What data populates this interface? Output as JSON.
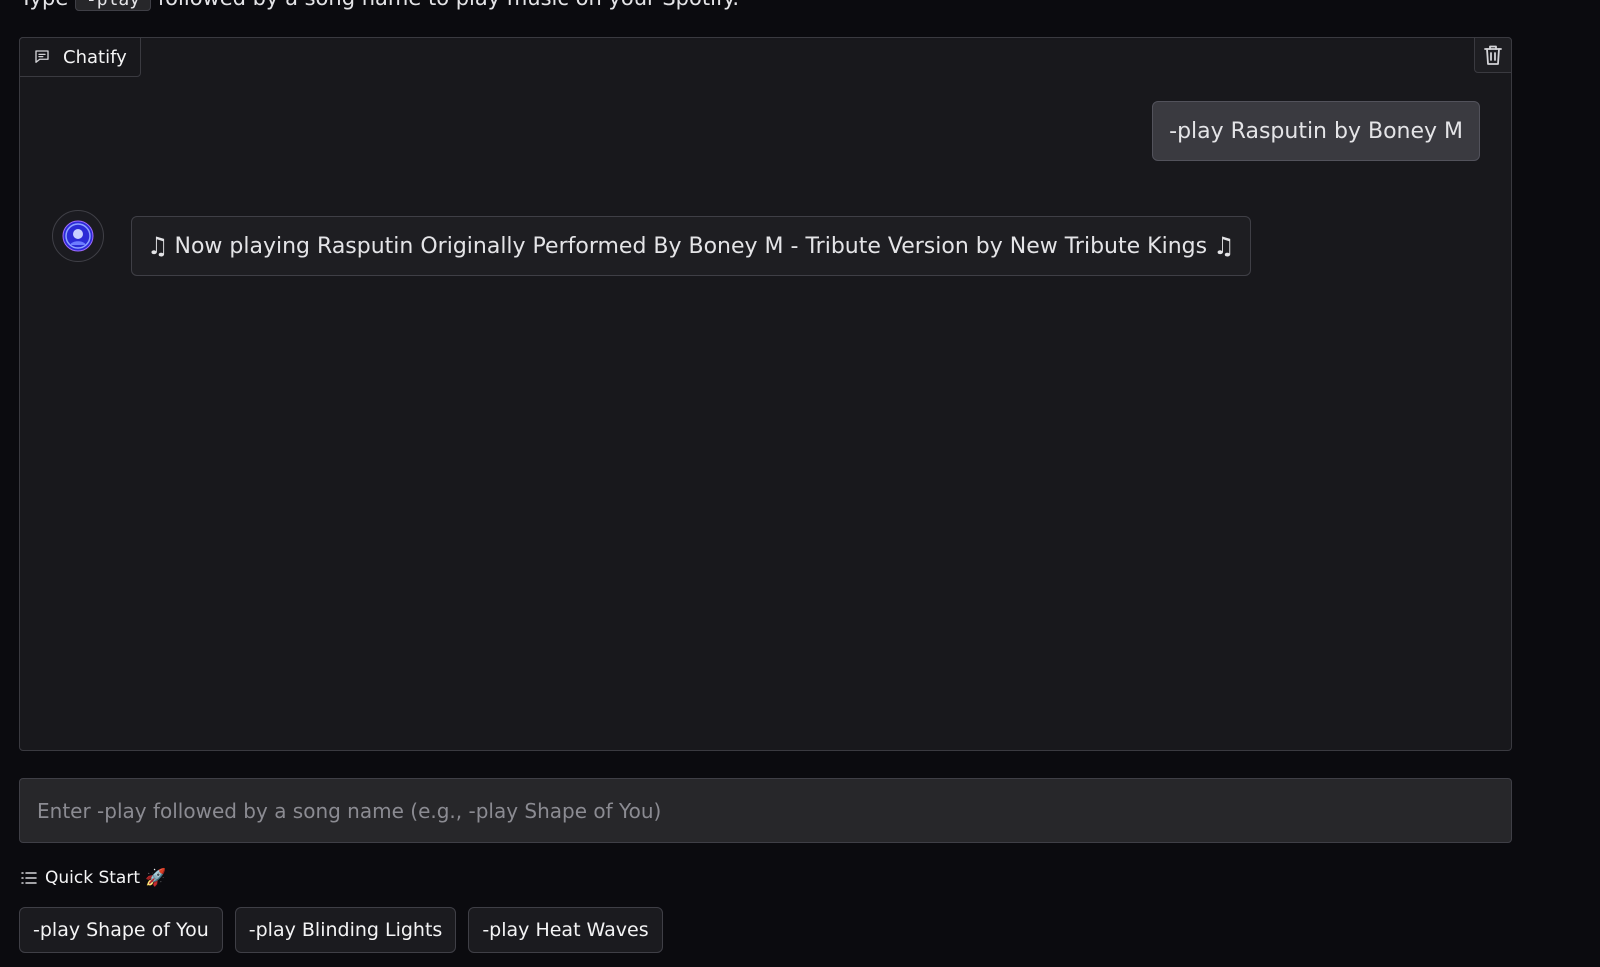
{
  "intro": {
    "prefix": "Type ",
    "code": "-play",
    "suffix": " followed by a song name to play music on your Spotify."
  },
  "chat": {
    "label": "Chatify",
    "messages": [
      {
        "role": "user",
        "text": "-play Rasputin by Boney M"
      },
      {
        "role": "bot",
        "text": "Now playing Rasputin Originally Performed By Boney M - Tribute Version by New Tribute Kings"
      }
    ],
    "note_glyph": "♫"
  },
  "input": {
    "placeholder": "Enter -play followed by a song name (e.g., -play Shape of You)",
    "value": ""
  },
  "quick_start": {
    "title": "Quick Start 🚀",
    "buttons": [
      "-play Shape of You",
      "-play Blinding Lights",
      "-play Heat Waves"
    ]
  },
  "colors": {
    "background": "#0b0b0f",
    "panel": "#18181c",
    "user_bubble": "#3a3a40",
    "avatar_accent": "#5b5bf7"
  }
}
